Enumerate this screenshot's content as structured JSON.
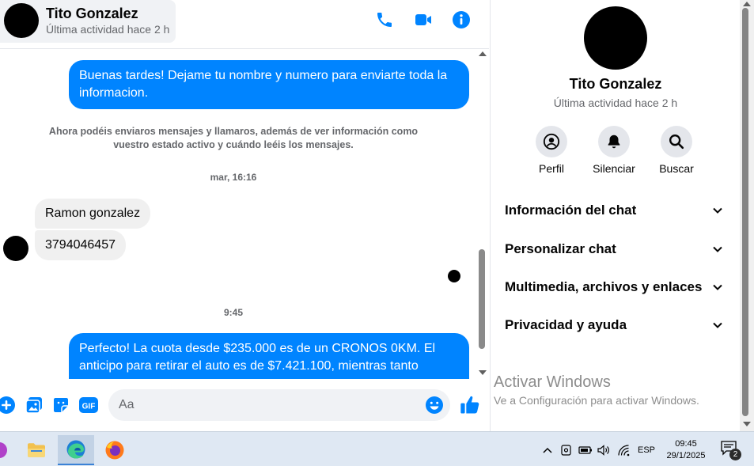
{
  "header": {
    "contact_name": "Tito Gonzalez",
    "status": "Última actividad hace 2 h"
  },
  "messages": {
    "out_1": "Buenas tardes! Dejame tu nombre y numero para enviarte toda la informacion.",
    "notice": "Ahora podéis enviaros mensajes y llamaros, además de ver información como vuestro estado activo y cuándo leéis los mensajes.",
    "timestamp_1": "mar, 16:16",
    "in_1": "Ramon gonzalez",
    "in_2": "3794046457",
    "timestamp_2": "9:45",
    "out_2": "Perfecto! La cuota desde $235.000 es de un CRONOS 0KM. El anticipo para retirar el auto es de $7.421.100, mientras tanto"
  },
  "composer": {
    "placeholder": "Aa",
    "gif_label": "GIF"
  },
  "info_panel": {
    "name": "Tito Gonzalez",
    "status": "Última actividad hace 2 h",
    "actions": [
      {
        "label": "Perfil",
        "icon": "user-circle-icon"
      },
      {
        "label": "Silenciar",
        "icon": "bell-icon"
      },
      {
        "label": "Buscar",
        "icon": "search-icon"
      }
    ],
    "sections": [
      {
        "label": "Información del chat"
      },
      {
        "label": "Personalizar chat"
      },
      {
        "label": "Multimedia, archivos y enlaces"
      },
      {
        "label": "Privacidad y ayuda"
      }
    ]
  },
  "watermark": {
    "title": "Activar Windows",
    "subtitle": "Ve a Configuración para activar Windows."
  },
  "taskbar": {
    "language": "ESP",
    "time": "09:45",
    "date": "29/1/2025",
    "notification_count": "2"
  },
  "colors": {
    "accent": "#0084ff",
    "incoming_bubble": "#f0f0f0",
    "secondary_text": "#65676b"
  }
}
